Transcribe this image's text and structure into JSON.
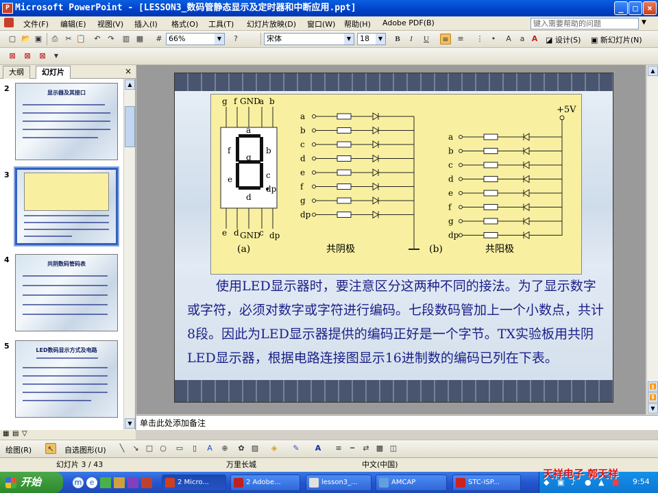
{
  "window": {
    "title": "Microsoft PowerPoint - [LESSON3_数码管静态显示及定时器和中断应用.ppt]"
  },
  "menu": {
    "items": [
      "文件(F)",
      "编辑(E)",
      "视图(V)",
      "插入(I)",
      "格式(O)",
      "工具(T)",
      "幻灯片放映(D)",
      "窗口(W)",
      "帮助(H)",
      "Adobe PDF(B)"
    ],
    "help_placeholder": "键入需要帮助的问题"
  },
  "toolbar": {
    "zoom": "66%",
    "font": "宋体",
    "font_size": "18",
    "bold": "B",
    "italic": "I",
    "underline": "U",
    "design": "设计(S)",
    "new_slide": "新幻灯片(N)"
  },
  "left_panel": {
    "tabs": [
      "大纲",
      "幻灯片"
    ],
    "thumbnails": [
      {
        "num": "2",
        "title": "显示器及其接口"
      },
      {
        "num": "3",
        "title": ""
      },
      {
        "num": "4",
        "title": "共阴数码管码表"
      },
      {
        "num": "5",
        "title": "LED数码显示方式及电路"
      }
    ]
  },
  "slide": {
    "left_top_labels": [
      "g",
      "f",
      "GND",
      "a",
      "b"
    ],
    "left_seg_labels": [
      "a",
      "f",
      "b",
      "g",
      "e",
      "c",
      "d",
      "dp"
    ],
    "left_bottom_labels": [
      "e",
      "d",
      "GND",
      "c",
      "dp"
    ],
    "left_caption": "(a)",
    "cathode_labels": [
      "a",
      "b",
      "c",
      "d",
      "e",
      "f",
      "g",
      "dp"
    ],
    "cathode_title": "共阴极",
    "right_caption": "(b)",
    "anode_labels": [
      "a",
      "b",
      "c",
      "d",
      "e",
      "f",
      "g",
      "dp"
    ],
    "anode_title": "共阳极",
    "vcc": "+5V",
    "body_text": "使用LED显示器时，要注意区分这两种不同的接法。为了显示数字或字符，必须对数字或字符进行编码。七段数码管加上一个小数点，共计8段。因此为LED显示器提供的编码正好是一个字节。TX实验板用共阴LED显示器，根据电路连接图显示16进制数的编码已列在下表。"
  },
  "notes": {
    "placeholder": "单击此处添加备注"
  },
  "drawing_toolbar": {
    "draw": "绘图(R)",
    "autoshapes": "自选图形(U)"
  },
  "status": {
    "slide": "幻灯片 3 / 43",
    "design": "万里长城",
    "lang": "中文(中国)"
  },
  "taskbar": {
    "start": "开始",
    "tasks": [
      "2 Micro...",
      "2 Adobe...",
      "lesson3_...",
      "AMCAP",
      "STC-ISP..."
    ],
    "time": "9:54",
    "watermark": "天祥电子  郭天祥"
  }
}
